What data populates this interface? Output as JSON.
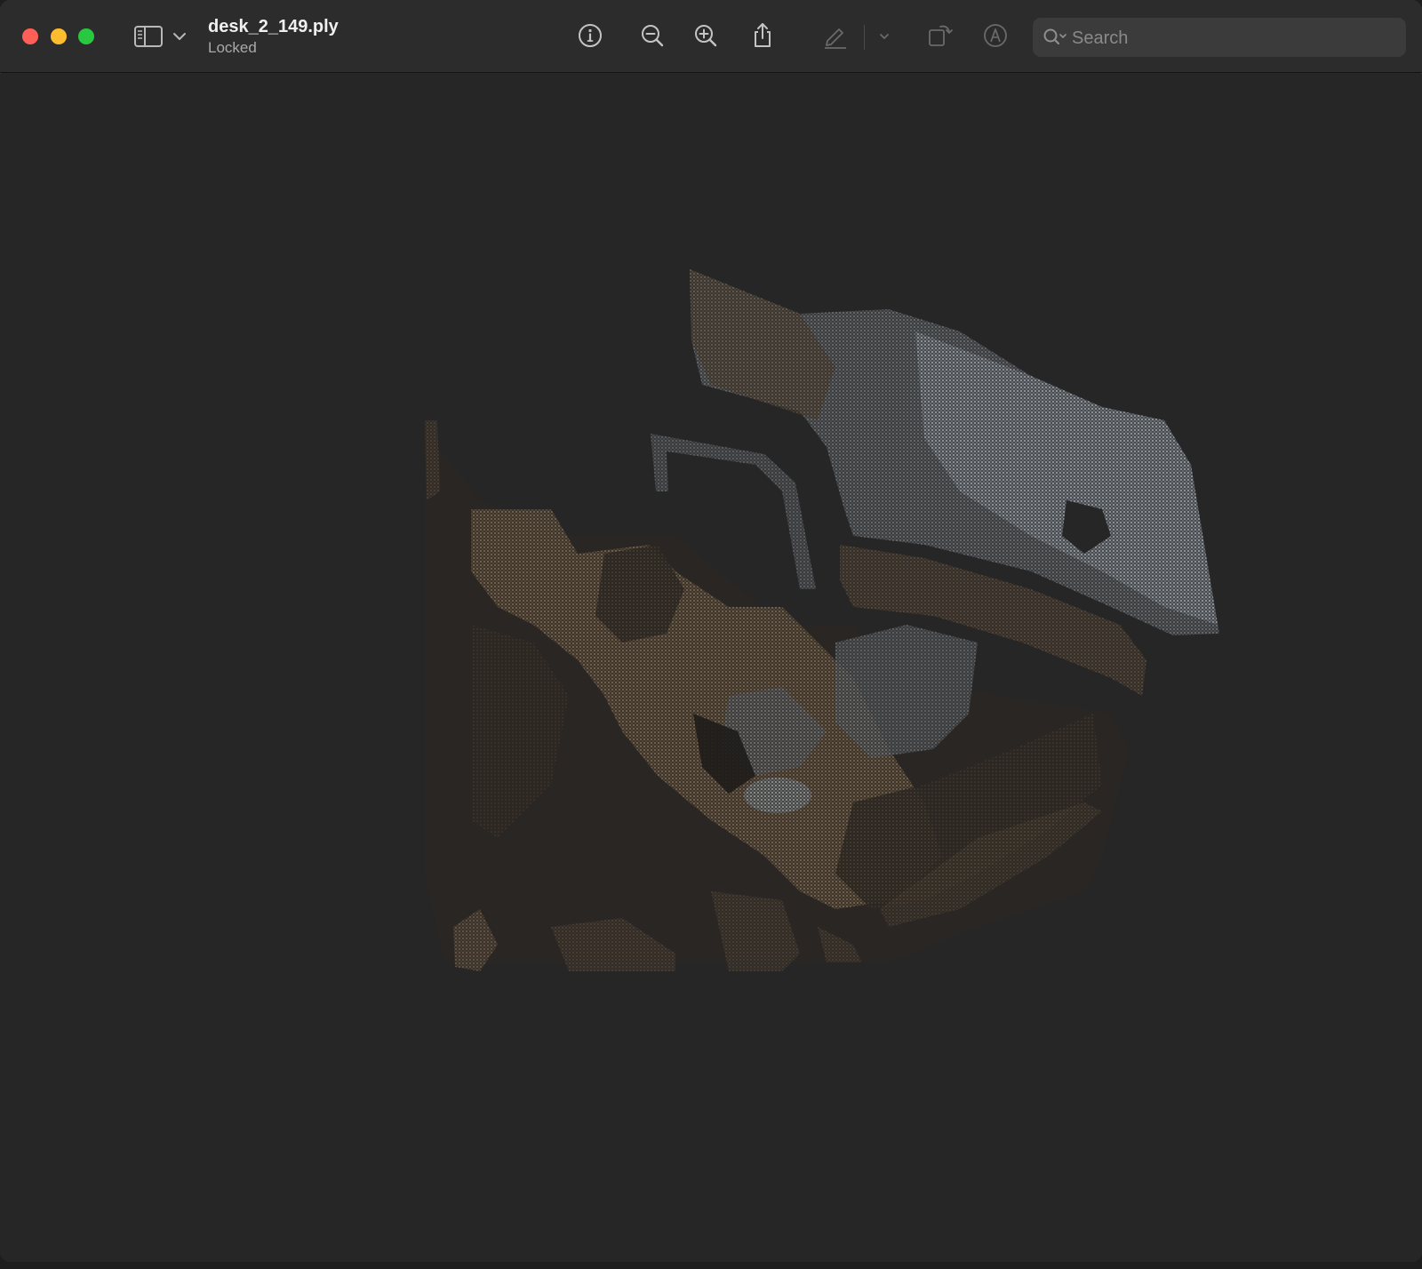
{
  "window": {
    "title": "desk_2_149.ply",
    "status": "Locked"
  },
  "toolbar": {
    "icons": [
      "sidebar-icon",
      "chevron-down-icon",
      "info-icon",
      "zoom-out-icon",
      "zoom-in-icon",
      "share-icon",
      "markup-pencil-icon",
      "chevron-down-icon",
      "rotate-icon",
      "annotate-icon"
    ]
  },
  "search": {
    "placeholder": "Search",
    "value": ""
  },
  "viewer": {
    "content": "point-cloud-render"
  },
  "colors": {
    "close": "#ff5f57",
    "minimize": "#febc2e",
    "maximize": "#28c840",
    "background": "#262626"
  }
}
